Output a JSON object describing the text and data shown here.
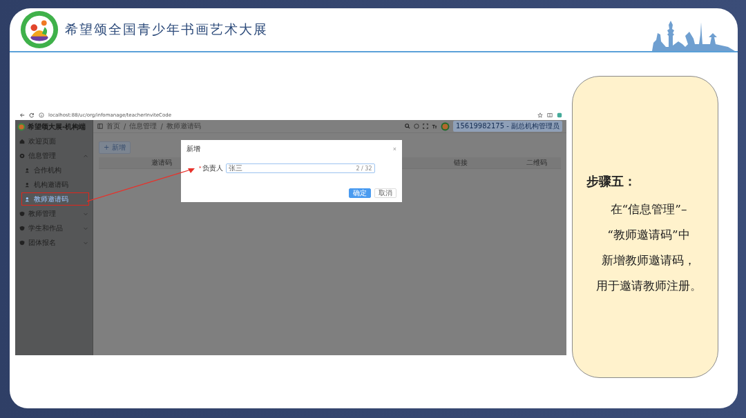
{
  "slide": {
    "title": "希望颂全国青少年书画艺术大展"
  },
  "browser": {
    "url": "localhost:88/uc/org/infomanage/teacherInviteCode"
  },
  "app": {
    "brand": "希望颂大展-机构端",
    "separator": "/",
    "breadcrumb": [
      "首页",
      "信息管理",
      "教师邀请码"
    ],
    "user": "15619982175 - 副总机构管理员",
    "sidebar": [
      {
        "label": "欢迎页面",
        "kind": "home"
      },
      {
        "label": "信息管理",
        "kind": "gear",
        "expanded": true,
        "children": [
          {
            "label": "合作机构",
            "selected": false
          },
          {
            "label": "机构邀请码",
            "selected": false
          },
          {
            "label": "教师邀请码",
            "selected": true
          }
        ]
      },
      {
        "label": "教师管理",
        "kind": "shield",
        "expanded": false
      },
      {
        "label": "学生和作品",
        "kind": "shield",
        "expanded": false
      },
      {
        "label": "团体报名",
        "kind": "shield",
        "expanded": false
      }
    ],
    "add_button": "+ 新增",
    "table": {
      "columns": [
        "邀请码",
        "链接",
        "二维码"
      ]
    }
  },
  "dialog": {
    "title": "新增",
    "close": "×",
    "field": {
      "required_mark": "*",
      "label": "负责人",
      "value": "张三",
      "count": "2 / 32"
    },
    "buttons": [
      {
        "label": "确定",
        "kind": "primary"
      },
      {
        "label": "取消",
        "kind": "plain"
      }
    ]
  },
  "step": {
    "title": "步骤五：",
    "lines": [
      "在“信息管理”–",
      "“教师邀请码”中",
      "新增教师邀请码，",
      "用于邀请教师注册。"
    ]
  }
}
